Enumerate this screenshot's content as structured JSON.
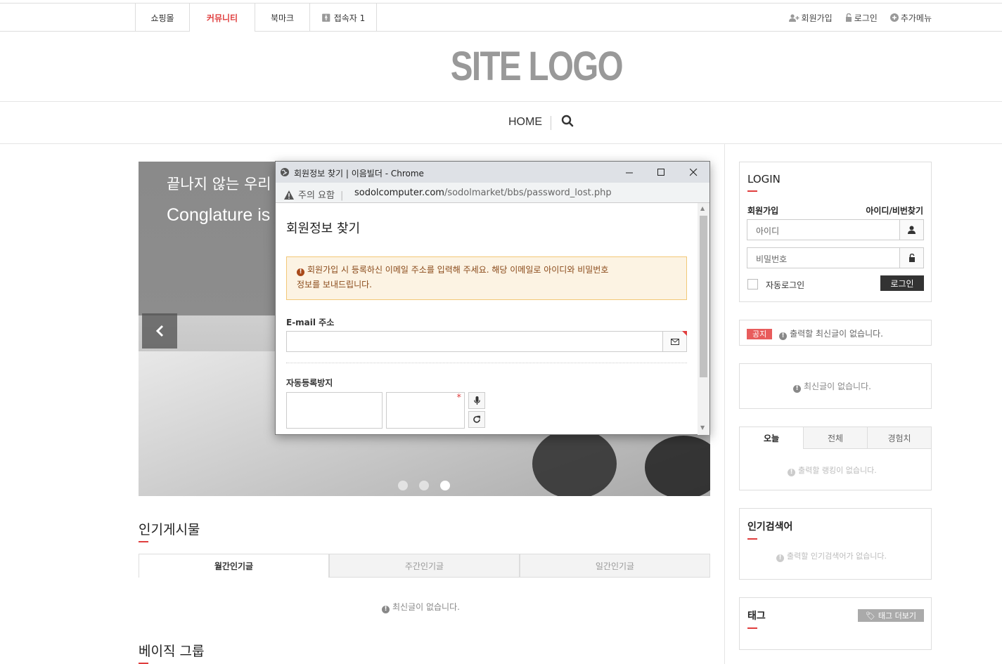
{
  "topbar": {
    "tabs": [
      {
        "label": "쇼핑몰"
      },
      {
        "label": "커뮤니티",
        "active": true
      },
      {
        "label": "북마크"
      },
      {
        "label": "접속자 1"
      }
    ],
    "right_links": [
      {
        "label": "회원가입",
        "icon": "user-plus-icon"
      },
      {
        "label": "로그인",
        "icon": "lock-icon"
      },
      {
        "label": "추가메뉴",
        "icon": "plus-circle-icon"
      }
    ]
  },
  "logo": {
    "text": "SITE LOGO"
  },
  "nav": {
    "home": "HOME",
    "search_icon": "search-icon"
  },
  "slider": {
    "text1": "끝나지 않는 우리",
    "text2": "Conglature is",
    "dots": 3,
    "active_dot": 3
  },
  "popular": {
    "title": "인기게시물",
    "tabs": [
      "월간인기글",
      "주간인기글",
      "일간인기글"
    ],
    "empty": "최신글이 없습니다."
  },
  "basic_group": {
    "title": "베이직 그룹"
  },
  "login_box": {
    "title": "LOGIN",
    "join": "회원가입",
    "find": "아이디/비번찾기",
    "id_placeholder": "아이디",
    "pw_placeholder": "비밀번호",
    "auto_login": "자동로그인",
    "login_button": "로그인"
  },
  "notice_box": {
    "badge": "공지",
    "text": "출력할 최신글이 없습니다."
  },
  "latest_box": {
    "text": "최신글이 없습니다."
  },
  "rank_box": {
    "tabs": [
      "오늘",
      "전체",
      "경험치"
    ],
    "empty": "출력할 랭킹이 없습니다."
  },
  "search_box": {
    "title": "인기검색어",
    "empty": "출력할 인기검색어가 없습니다."
  },
  "tag_box": {
    "title": "태그",
    "more": "태그 더보기"
  },
  "popup": {
    "window_title": "회원정보 찾기 | 이음빌더 - Chrome",
    "warning": "주의 요함",
    "url_domain": "sodolcomputer.com",
    "url_path": "/sodolmarket/bbs/password_lost.php",
    "heading": "회원정보 찾기",
    "alert_line1": "회원가입 시 등록하신 이메일 주소를 입력해 주세요. 해당 이메일로 아이디와 비밀번호",
    "alert_line2": "정보를 보내드립니다.",
    "email_label": "E-mail 주소",
    "captcha_label": "자동등록방지",
    "required_mark": "*"
  },
  "colors": {
    "accent": "#e03e3e",
    "alert_bg": "#fcf3e3",
    "alert_border": "#f2c877"
  }
}
